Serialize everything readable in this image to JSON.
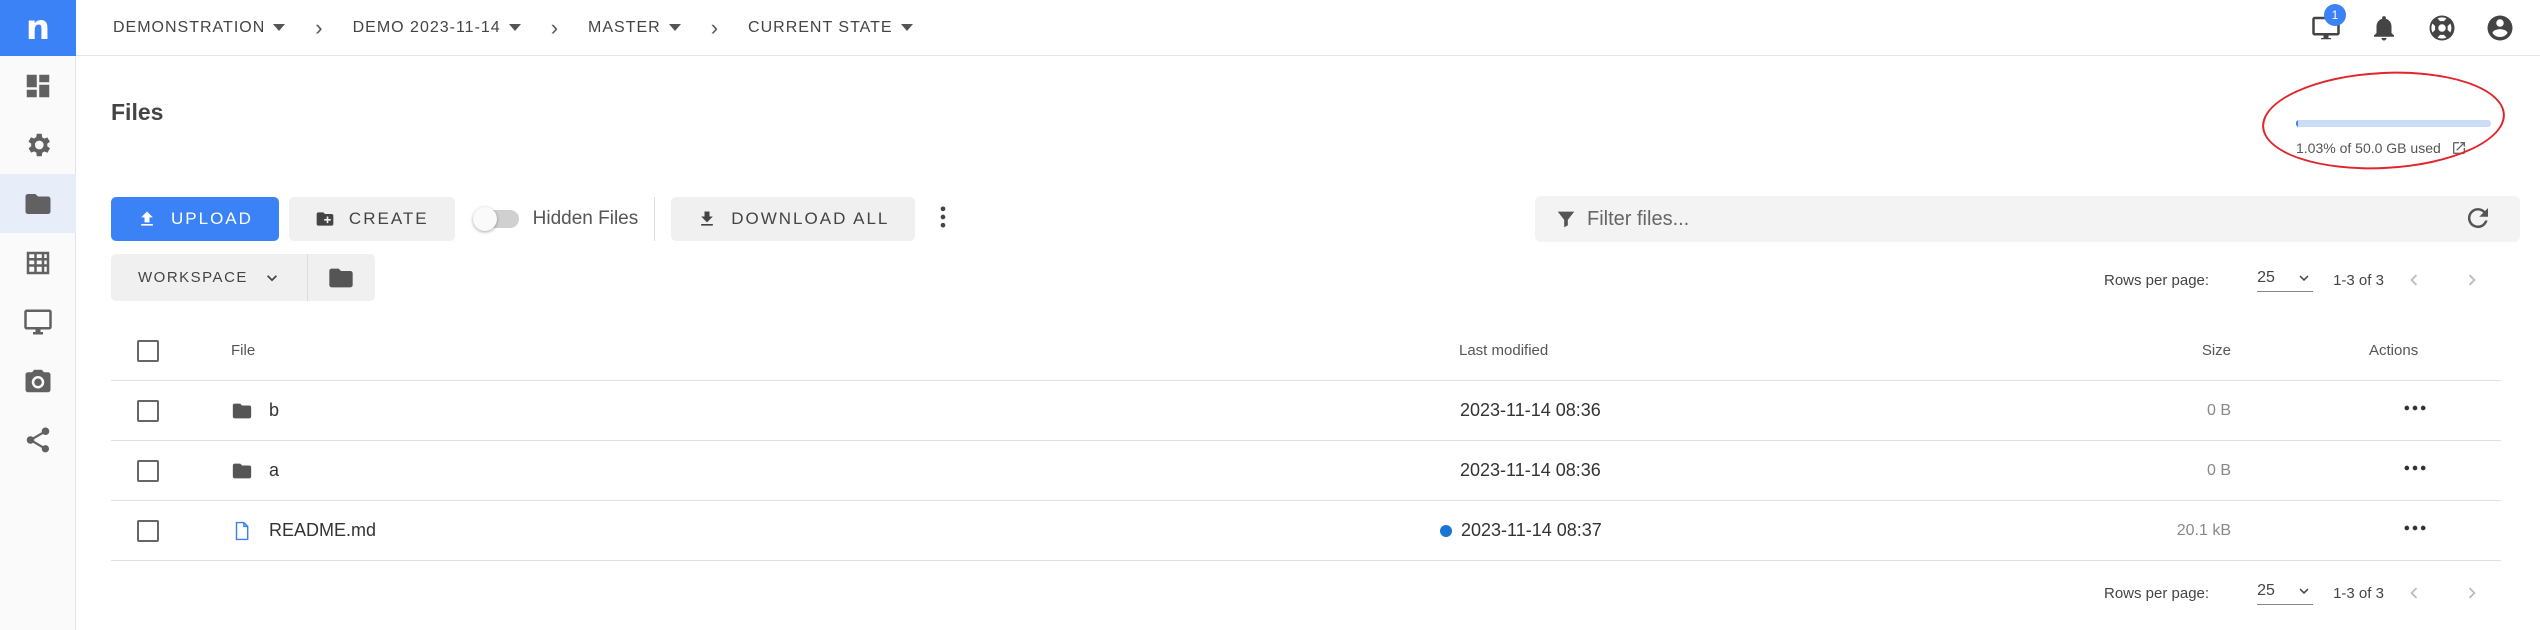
{
  "app": {
    "logo_text": "n",
    "accent_color": "#3b82f6",
    "annotation_color": "#e0262c"
  },
  "sidebar": {
    "items": [
      {
        "icon": "dashboard-icon",
        "active": false
      },
      {
        "icon": "gear-icon",
        "active": false
      },
      {
        "icon": "folder-icon",
        "active": true
      },
      {
        "icon": "table-icon",
        "active": false
      },
      {
        "icon": "monitor-icon",
        "active": false
      },
      {
        "icon": "camera-icon",
        "active": false
      },
      {
        "icon": "share-icon",
        "active": false
      }
    ]
  },
  "breadcrumb": {
    "items": [
      "DEMONSTRATION",
      "DEMO 2023-11-14",
      "MASTER",
      "CURRENT STATE"
    ]
  },
  "header": {
    "notification_count": "1",
    "icons": [
      "monitor-icon",
      "bell-icon",
      "support-icon",
      "account-icon"
    ]
  },
  "main": {
    "title": "Files"
  },
  "storage": {
    "used_fraction": 0.0103,
    "text": "1.03% of 50.0 GB used"
  },
  "toolbar": {
    "upload_label": "UPLOAD",
    "create_label": "CREATE",
    "hidden_files_label": "Hidden Files",
    "hidden_files_on": false,
    "download_all_label": "DOWNLOAD ALL"
  },
  "filter": {
    "placeholder": "Filter files..."
  },
  "workspace": {
    "label": "WORKSPACE"
  },
  "pagination": {
    "rows_per_page_label": "Rows per page:",
    "rows_per_page": "25",
    "range": "1-3 of 3"
  },
  "table": {
    "columns": {
      "file": "File",
      "last_modified": "Last modified",
      "size": "Size",
      "actions": "Actions"
    },
    "rows": [
      {
        "name": "b",
        "type": "folder",
        "modified": "2023-11-14 08:36",
        "size": "0 B",
        "modified_dot": false
      },
      {
        "name": "a",
        "type": "folder",
        "modified": "2023-11-14 08:36",
        "size": "0 B",
        "modified_dot": false
      },
      {
        "name": "README.md",
        "type": "file",
        "modified": "2023-11-14 08:37",
        "size": "20.1 kB",
        "modified_dot": true
      }
    ]
  }
}
